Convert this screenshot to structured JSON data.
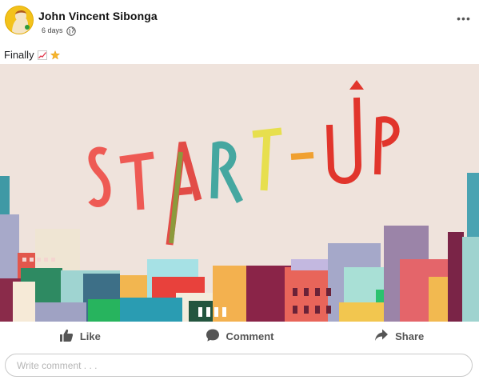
{
  "post": {
    "author": "John Vincent Sibonga",
    "time": "6 days",
    "more_label": "•••",
    "caption": "Finally"
  },
  "image": {
    "title_letters": [
      "S",
      "T",
      "A",
      "R",
      "T",
      "-",
      "U",
      "P"
    ]
  },
  "actions": {
    "like_label": "Like",
    "comment_label": "Comment",
    "share_label": "Share"
  },
  "comment": {
    "placeholder": "Write comment . . ."
  },
  "icons": {
    "globe": "globe-icon",
    "chart_emoji": "chart-increasing-icon",
    "star_emoji": "star-icon",
    "like": "thumbs-up-icon",
    "comment": "speech-bubble-icon",
    "share": "share-arrow-icon",
    "more": "more-options-icon"
  },
  "colors": {
    "image_background": "#efe3dc",
    "action_text": "#555555"
  }
}
